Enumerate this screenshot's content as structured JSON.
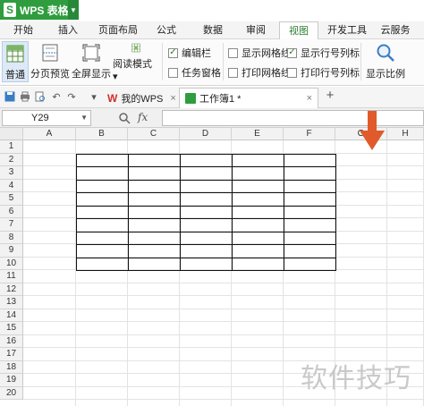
{
  "app": {
    "title": "WPS 表格",
    "logo": "S"
  },
  "menu": [
    "开始",
    "插入",
    "页面布局",
    "公式",
    "数据",
    "审阅",
    "视图",
    "开发工具",
    "云服务"
  ],
  "menu_active": "视图",
  "ribbon": {
    "normal": "普通",
    "page_break": "分页预览",
    "fullscreen": "全屏显示",
    "reading_mode": "阅读模式",
    "edit_bar": "编辑栏",
    "task_pane": "任务窗格",
    "show_gridlines": "显示网格线",
    "print_gridlines": "打印网格线",
    "show_headings": "显示行号列标",
    "print_headings": "打印行号列标",
    "zoom": "显示比例"
  },
  "quickbar": {
    "doc1": "我的WPS",
    "doc2": "工作簿1 *",
    "doc2_close": "×",
    "doc1_close": "×",
    "new_tab": "+"
  },
  "formula": {
    "name_box": "Y29",
    "fx": "fx"
  },
  "columns": [
    "A",
    "B",
    "C",
    "D",
    "E",
    "F",
    "G",
    "H"
  ],
  "rows": [
    "1",
    "2",
    "3",
    "4",
    "5",
    "6",
    "7",
    "8",
    "9",
    "10",
    "11",
    "12",
    "13",
    "14",
    "15",
    "16",
    "17",
    "18",
    "19",
    "20"
  ],
  "watermark": "软件技巧",
  "colors": {
    "accent": "#2f9d3e",
    "arrow": "#e05a2b"
  }
}
